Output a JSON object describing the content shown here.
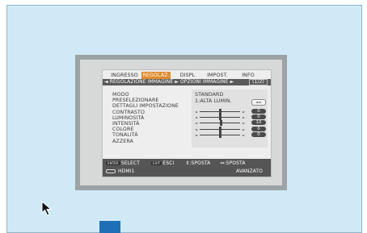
{
  "osd": {
    "tabs": [
      "INGRESSO",
      "REGOLAZ.",
      "DISPL",
      "IMPOST.",
      "INFO"
    ],
    "active_tab": "REGOLAZ.",
    "submenu": {
      "path": "◄ REGOLAZIONE IMMAGINE ► OPZIONI IMMAGINE ►",
      "page": "1/2"
    },
    "items": [
      "MODO",
      "PRESELEZIONARE",
      "DETTAGLI IMPOSTAZIONE",
      "CONTRASTO",
      "LUMINOSITÀ",
      "INTENSITÀ",
      "COLORE",
      "TONALITÀ",
      "AZZERA"
    ],
    "values": {
      "modo": "STANDARD",
      "preselezionare": "1:ALTA LUMIN."
    },
    "sliders": [
      {
        "name": "CONTRASTO",
        "value": "0",
        "fraction": 0.5
      },
      {
        "name": "LUMINOSITÀ",
        "value": "0",
        "fraction": 0.5
      },
      {
        "name": "INTENSITÀ",
        "value": "10",
        "fraction": 0.52
      },
      {
        "name": "COLORE",
        "value": "0",
        "fraction": 0.5
      },
      {
        "name": "TONALITÀ",
        "value": "0",
        "fraction": 0.5
      }
    ],
    "footer": {
      "enter_key": "ENTER",
      "select": "SELECT",
      "exit_key": "EXIT",
      "esci": "ESCI",
      "sposta1": "⇕:SPOSTA",
      "sposta2": "⇔:SPOSTA",
      "source": "HDMI1",
      "mode": "AVANZATO"
    }
  },
  "colors": {
    "screen_bg": "#cfeaf6",
    "tab_active": "#e08a2c",
    "accent_blue": "#1f6fb6"
  }
}
